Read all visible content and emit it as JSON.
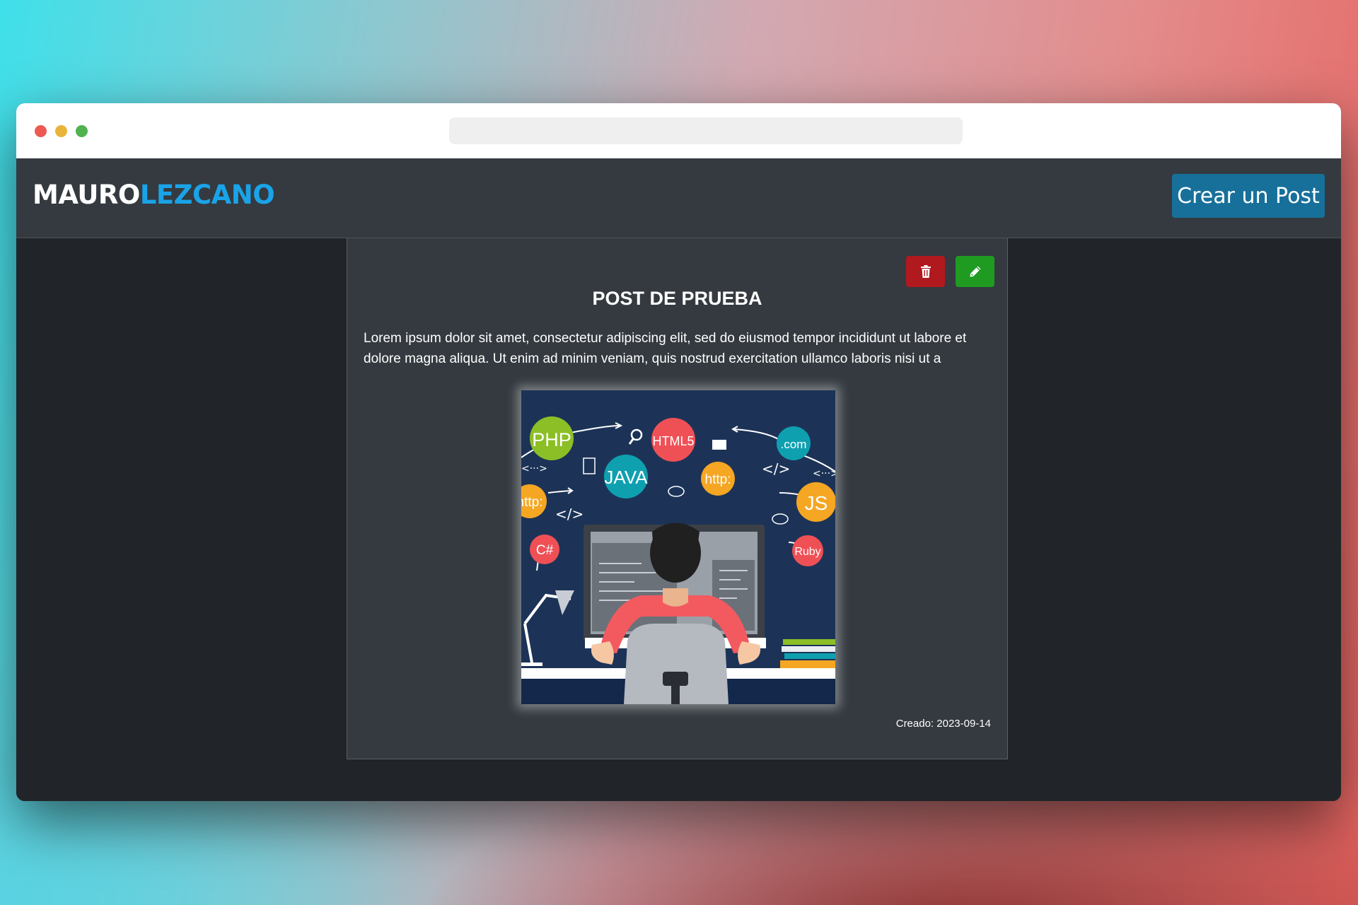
{
  "brand": {
    "first": "MAURO",
    "second": "LEZCANO"
  },
  "navbar": {
    "create_label": "Crear un Post"
  },
  "post": {
    "title": "POST DE PRUEBA",
    "body": "Lorem ipsum dolor sit amet, consectetur adipiscing elit, sed do eiusmod tempor incididunt ut labore et dolore magna aliqua. Ut enim ad minim veniam, quis nostrud exercitation ullamco laboris nisi ut a",
    "created": "Creado: 2023-09-14",
    "actions": {
      "delete_icon": "trash-icon",
      "edit_icon": "pencil-icon"
    },
    "image": {
      "badges": [
        "PHP",
        "HTML5",
        ".com",
        "JAVA",
        "http:",
        "http:",
        "JS",
        "C#",
        "Ruby"
      ],
      "code_tags": [
        "</>",
        "</>",
        "<···>",
        "<···>"
      ]
    }
  },
  "colors": {
    "navbar": "#343a40",
    "background": "#212529",
    "brand_accent": "#1aa3e8",
    "create_button": "#17709a",
    "delete_button": "#b0191e",
    "edit_button": "#1f9b22"
  }
}
